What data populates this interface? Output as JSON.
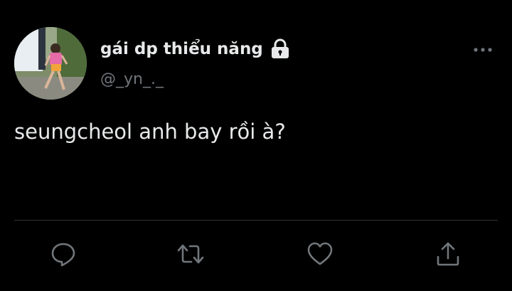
{
  "tweet": {
    "display_name": "gái dp thiểu năng",
    "handle": "@_yn_._",
    "text": "seungcheol anh bay rồi à?",
    "protected_icon": "lock-icon",
    "avatar_icon": "avatar-photo",
    "more_icon": "more-horizontal-icon"
  },
  "actions": [
    {
      "icon": "reply-icon"
    },
    {
      "icon": "retweet-icon"
    },
    {
      "icon": "like-icon"
    },
    {
      "icon": "share-icon"
    }
  ],
  "colors": {
    "background": "#000000",
    "primary_text": "#e7e9ea",
    "secondary_text": "#71767b",
    "divider": "#2f3336"
  }
}
